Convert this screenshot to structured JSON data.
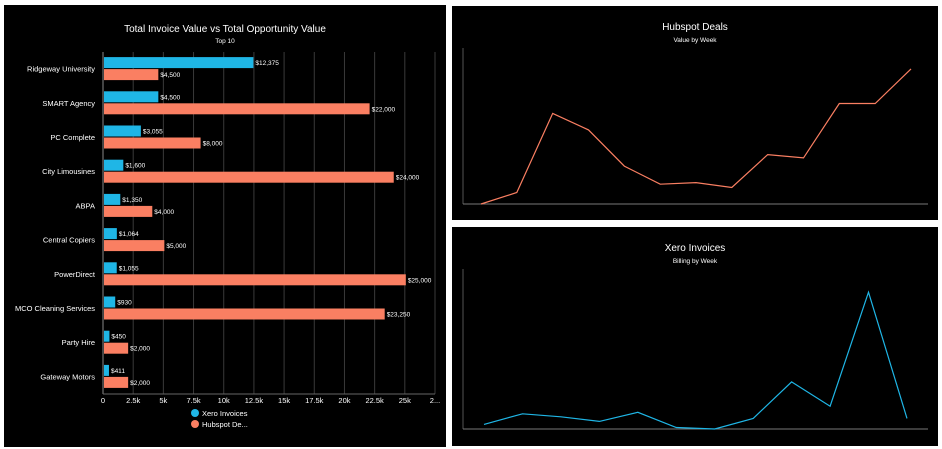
{
  "chart_data": [
    {
      "type": "bar",
      "orientation": "horizontal",
      "title": "Total Invoice Value vs Total Opportunity Value",
      "subtitle": "Top 10",
      "categories": [
        "Ridgeway University",
        "SMART Agency",
        "PC Complete",
        "City Limousines",
        "ABPA",
        "Central Copiers",
        "PowerDirect",
        "MCO Cleaning Services",
        "Party Hire",
        "Gateway Motors"
      ],
      "series": [
        {
          "name": "Xero Invoices",
          "color": "#1fb6e6",
          "values": [
            12375,
            4500,
            3055,
            1600,
            1350,
            1064,
            1055,
            930,
            450,
            411
          ],
          "labels": [
            "$12,375",
            "$4,500",
            "$3,055",
            "$1,600",
            "$1,350",
            "$1,064",
            "$1,055",
            "$930",
            "$450",
            "$411"
          ]
        },
        {
          "name": "Hubspot De...",
          "color": "#fa7f62",
          "values": [
            4500,
            22000,
            8000,
            24000,
            4000,
            5000,
            25000,
            23250,
            2000,
            2000
          ],
          "labels": [
            "$4,500",
            "$22,000",
            "$8,000",
            "$24,000",
            "$4,000",
            "$5,000",
            "$25,000",
            "$23,250",
            "$2,000",
            "$2,000"
          ]
        }
      ],
      "xlim": [
        0,
        27500
      ],
      "xticks": [
        "0",
        "2.5k",
        "5k",
        "7.5k",
        "10k",
        "12.5k",
        "15k",
        "17.5k",
        "20k",
        "22.5k",
        "25k",
        "2..."
      ],
      "grid": true,
      "legend": "bottom"
    },
    {
      "type": "line",
      "title": "Hubspot Deals",
      "subtitle": "Value by Week",
      "color": "#fa7f62",
      "values": [
        0,
        7,
        55,
        45,
        23,
        12,
        13,
        10,
        30,
        28,
        61,
        61,
        82
      ],
      "ylim": [
        0,
        85
      ]
    },
    {
      "type": "line",
      "title": "Xero Invoices",
      "subtitle": "Billing by Week",
      "color": "#1fb6e6",
      "values": [
        3,
        10,
        8,
        5,
        11,
        1,
        0,
        7,
        31,
        15,
        90,
        7
      ],
      "ylim": [
        0,
        100
      ]
    }
  ]
}
